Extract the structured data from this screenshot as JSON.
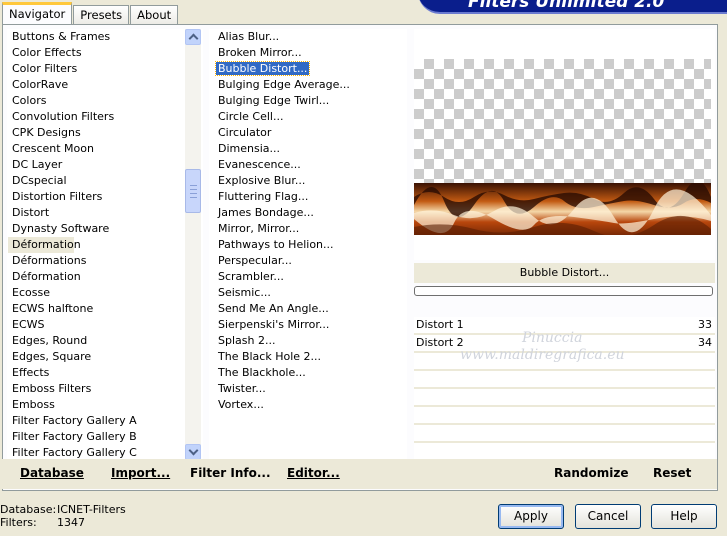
{
  "app": {
    "brand": "Filters Unlimited 2.0"
  },
  "tabs": [
    "Navigator",
    "Presets",
    "About"
  ],
  "categories": [
    "Buttons & Frames",
    "Color Effects",
    "Color Filters",
    "ColorRave",
    "Colors",
    "Convolution Filters",
    "CPK Designs",
    "Crescent Moon",
    "DC Layer",
    "DCspecial",
    "Distortion Filters",
    "Distort",
    "Dynasty Software",
    "Déformation",
    "Déformations",
    "Déformation",
    "Ecosse",
    "ECWS halftone",
    "ECWS",
    "Edges, Round",
    "Edges, Square",
    "Effects",
    "Emboss Filters",
    "Emboss",
    "Filter Factory Gallery A",
    "Filter Factory Gallery B",
    "Filter Factory Gallery C"
  ],
  "filters": [
    "Alias Blur...",
    "Broken Mirror...",
    "Bubble Distort...",
    "Bulging Edge Average...",
    "Bulging Edge Twirl...",
    "Circle Cell...",
    "Circulator",
    "Dimensia...",
    "Evanescence...",
    "Explosive Blur...",
    "Fluttering Flag...",
    "James Bondage...",
    "Mirror, Mirror...",
    "Pathways to Helion...",
    "Perspecular...",
    "Scrambler...",
    "Seismic...",
    "Send Me An Angle...",
    "Sierpenski's Mirror...",
    "Splash 2...",
    "The Black Hole 2...",
    "The Blackhole...",
    "Twister...",
    "Vortex..."
  ],
  "preview": {
    "filter_name": "Bubble Distort..."
  },
  "params": [
    {
      "label": "Distort 1",
      "value": "33"
    },
    {
      "label": "Distort 2",
      "value": "34"
    }
  ],
  "watermark": {
    "line1": "Pinuccia",
    "line2": "www.maldiregrafica.eu"
  },
  "toolbar": {
    "database": "Database",
    "import": "Import...",
    "filter_info": "Filter Info...",
    "editor": "Editor...",
    "randomize": "Randomize",
    "reset": "Reset"
  },
  "status": {
    "database_label": "Database:",
    "database_value": "ICNET-Filters",
    "filters_label": "Filters:",
    "filters_value": "1347"
  },
  "buttons": {
    "apply": "Apply",
    "cancel": "Cancel",
    "help": "Help"
  }
}
